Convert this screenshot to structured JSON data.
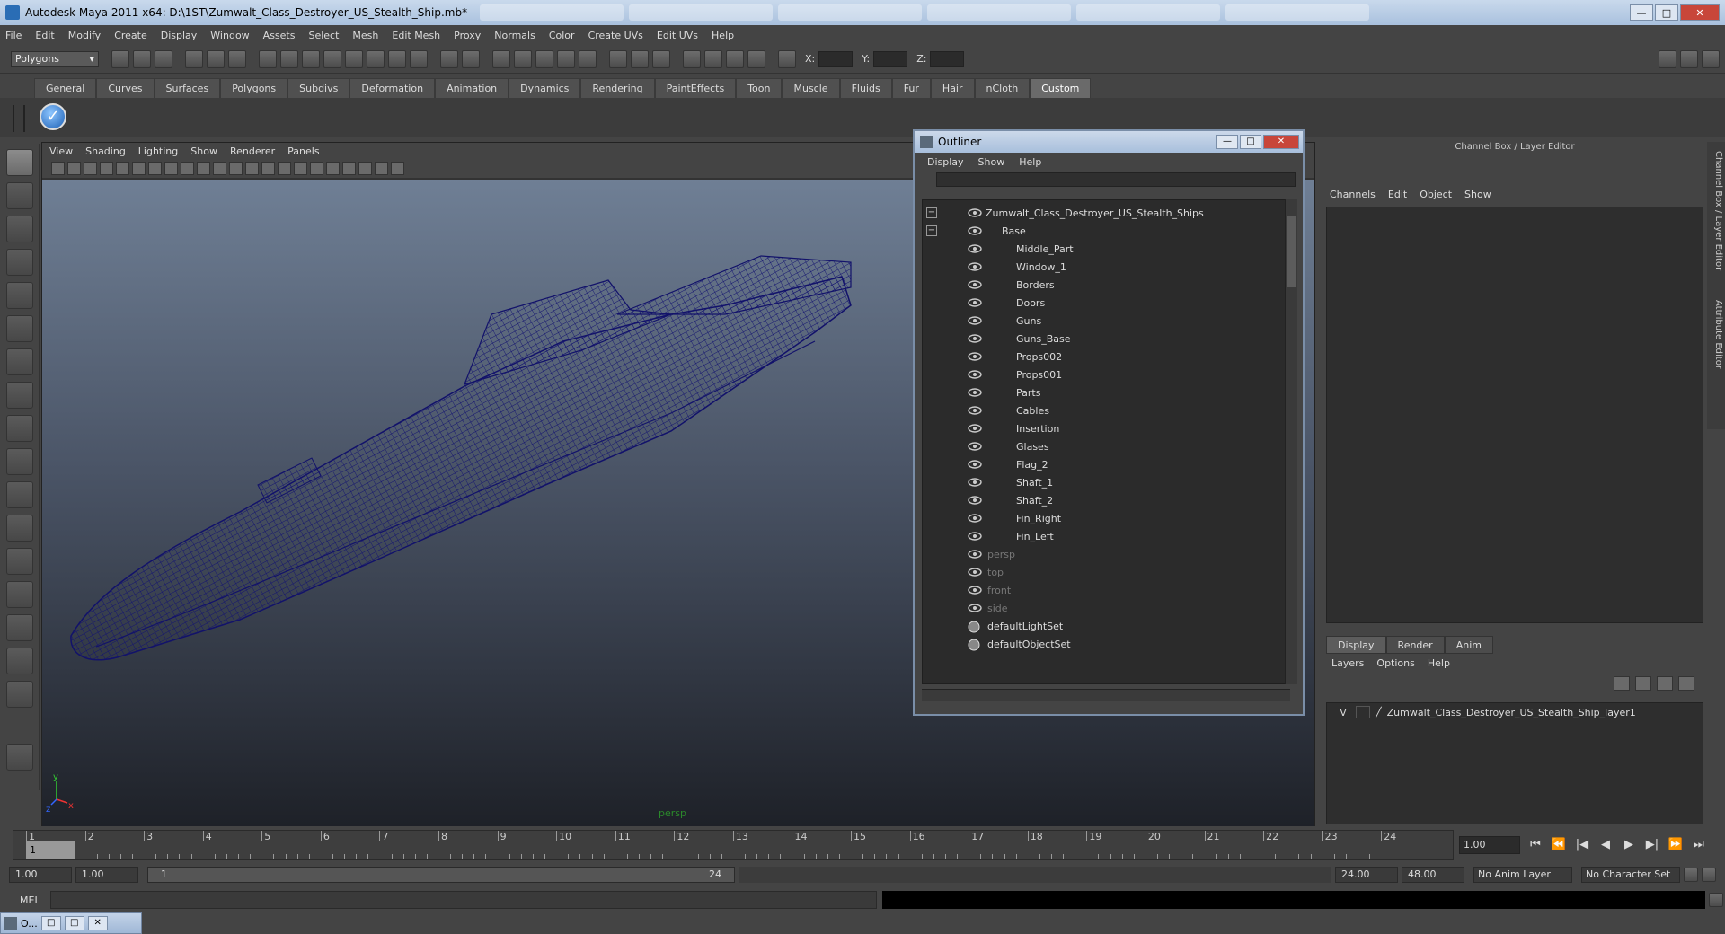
{
  "window": {
    "title": "Autodesk Maya 2011 x64: D:\\1ST\\Zumwalt_Class_Destroyer_US_Stealth_Ship.mb*",
    "min": "—",
    "max": "□",
    "close": "✕"
  },
  "menubar": [
    "File",
    "Edit",
    "Modify",
    "Create",
    "Display",
    "Window",
    "Assets",
    "Select",
    "Mesh",
    "Edit Mesh",
    "Proxy",
    "Normals",
    "Color",
    "Create UVs",
    "Edit UVs",
    "Help"
  ],
  "statusline": {
    "mode": "Polygons",
    "x_label": "X:",
    "y_label": "Y:",
    "z_label": "Z:"
  },
  "shelf_tabs": [
    "General",
    "Curves",
    "Surfaces",
    "Polygons",
    "Subdivs",
    "Deformation",
    "Animation",
    "Dynamics",
    "Rendering",
    "PaintEffects",
    "Toon",
    "Muscle",
    "Fluids",
    "Fur",
    "Hair",
    "nCloth",
    "Custom"
  ],
  "shelf_active": "Custom",
  "viewport": {
    "menu": [
      "View",
      "Shading",
      "Lighting",
      "Show",
      "Renderer",
      "Panels"
    ],
    "camera_label": "persp",
    "wire_color": "#1a1a7a"
  },
  "outliner": {
    "title": "Outliner",
    "menu": [
      "Display",
      "Show",
      "Help"
    ],
    "root": "Zumwalt_Class_Destroyer_US_Stealth_Ships",
    "group": "Base",
    "children": [
      "Middle_Part",
      "Window_1",
      "Borders",
      "Doors",
      "Guns",
      "Guns_Base",
      "Props002",
      "Props001",
      "Parts",
      "Cables",
      "Insertion",
      "Glases",
      "Flag_2",
      "Shaft_1",
      "Shaft_2",
      "Fin_Right",
      "Fin_Left"
    ],
    "cameras": [
      "persp",
      "top",
      "front",
      "side"
    ],
    "sets": [
      "defaultLightSet",
      "defaultObjectSet"
    ]
  },
  "channelbox": {
    "header": "Channel Box / Layer Editor",
    "menu": [
      "Channels",
      "Edit",
      "Object",
      "Show"
    ]
  },
  "side_tabs": [
    "Channel Box / Layer Editor",
    "Attribute Editor"
  ],
  "layereditor": {
    "tabs": [
      "Display",
      "Render",
      "Anim"
    ],
    "menu": [
      "Layers",
      "Options",
      "Help"
    ],
    "layer_visible": "V",
    "layer_name": "Zumwalt_Class_Destroyer_US_Stealth_Ship_layer1"
  },
  "timeslider": {
    "ticks": [
      "1",
      "2",
      "3",
      "4",
      "5",
      "6",
      "7",
      "8",
      "9",
      "10",
      "11",
      "12",
      "13",
      "14",
      "15",
      "16",
      "17",
      "18",
      "19",
      "20",
      "21",
      "22",
      "23",
      "24"
    ],
    "current_frame": "1",
    "current_field": "1.00"
  },
  "playback_buttons": [
    "⏮",
    "⏪",
    "|◀",
    "◀",
    "▶",
    "▶|",
    "⏩",
    "⏭"
  ],
  "rangeslider": {
    "start": "1.00",
    "playback_start": "1.00",
    "range_start": "1",
    "range_end": "24",
    "playback_end": "24.00",
    "end": "48.00",
    "anim_layer": "No Anim Layer",
    "char_set": "No Character Set"
  },
  "cmdline": {
    "label": "MEL"
  },
  "minimized_window": {
    "label": "O..."
  }
}
